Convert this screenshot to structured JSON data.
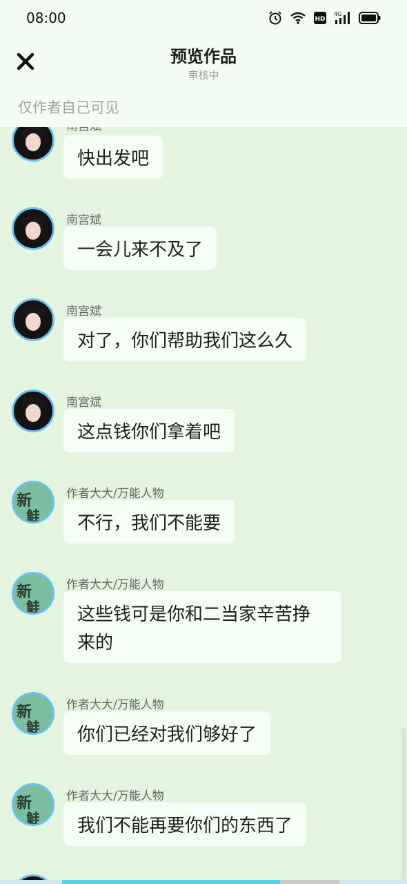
{
  "status_bar": {
    "time": "08:00"
  },
  "header": {
    "title": "预览作品",
    "subtitle": "审核中",
    "visibility_note": "仅作者自己可见"
  },
  "messages": [
    {
      "sender": "南宫斌",
      "text": "快出发吧",
      "avatar": "photo"
    },
    {
      "sender": "南宫斌",
      "text": "一会儿来不及了",
      "avatar": "photo"
    },
    {
      "sender": "南宫斌",
      "text": "对了，你们帮助我们这么久",
      "avatar": "photo"
    },
    {
      "sender": "南宫斌",
      "text": "这点钱你们拿着吧",
      "avatar": "photo"
    },
    {
      "sender": "作者大大/万能人物",
      "text": "不行，我们不能要",
      "avatar": "text"
    },
    {
      "sender": "作者大大/万能人物",
      "text": "这些钱可是你和二当家辛苦挣来的",
      "avatar": "text"
    },
    {
      "sender": "作者大大/万能人物",
      "text": "你们已经对我们够好了",
      "avatar": "text"
    },
    {
      "sender": "作者大大/万能人物",
      "text": "我们不能再要你们的东西了",
      "avatar": "text"
    }
  ],
  "text_avatar": {
    "line1": "新",
    "line2": "鮭"
  },
  "colors": {
    "background": "#e4f5df",
    "bubble": "#f6fff6",
    "avatar_border": "#6cc0ef"
  }
}
